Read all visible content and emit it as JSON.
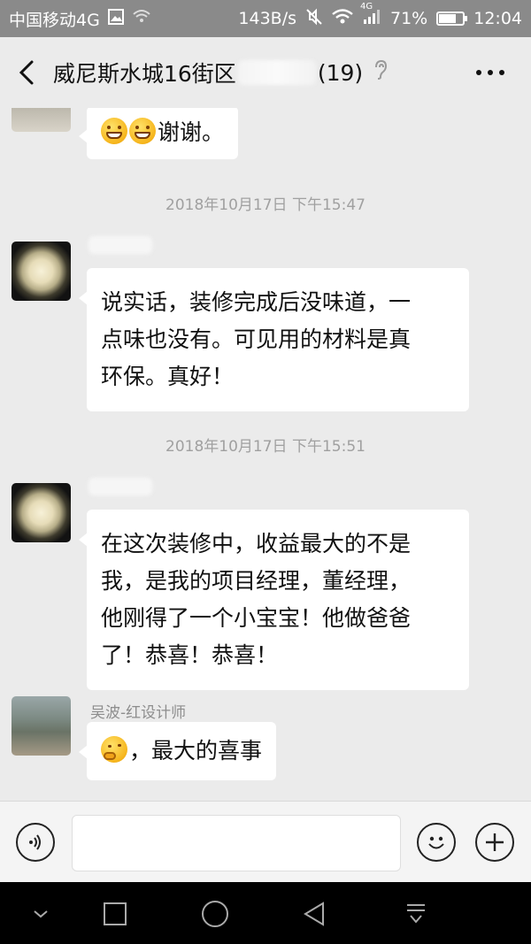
{
  "status_bar": {
    "carrier": "中国移动4G",
    "net_speed": "143B/s",
    "signal_label": "4G",
    "battery_percent": "71%",
    "battery_level": 0.71,
    "time": "12:04"
  },
  "header": {
    "title_prefix": "威尼斯水城16街区",
    "member_count": "(19)"
  },
  "messages": [
    {
      "type": "bubble",
      "text": "谢谢。",
      "emojis": [
        "grinning-face",
        "grinning-face"
      ]
    },
    {
      "type": "timestamp",
      "text": "2018年10月17日 下午15:47"
    },
    {
      "type": "bubble",
      "lines": [
        "说实话，装修完成后没味道，一",
        "点味也没有。可见用的材料是真",
        "环保。真好！"
      ]
    },
    {
      "type": "timestamp",
      "text": "2018年10月17日 下午15:51"
    },
    {
      "type": "bubble",
      "lines": [
        "在这次装修中，收益最大的不是",
        "我，是我的项目经理，董经理，",
        "他刚得了一个小宝宝！他做爸爸",
        "了！恭喜！恭喜！"
      ]
    },
    {
      "type": "bubble",
      "sender": "吴波-红设计师",
      "text": "，最大的喜事",
      "emojis": [
        "thinking-face"
      ]
    }
  ],
  "input": {
    "placeholder": ""
  },
  "colors": {
    "status_bar_bg": "#8a8a8a",
    "chat_bg": "#ebebeb",
    "bubble_bg": "#ffffff",
    "nav_bg": "#000000"
  }
}
